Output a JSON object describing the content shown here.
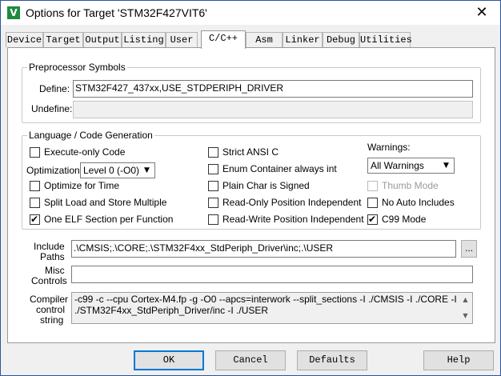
{
  "window": {
    "title": "Options for Target 'STM32F427VIT6'",
    "close_glyph": "✕",
    "app_icon_glyph": "V"
  },
  "tabs": [
    "Device",
    "Target",
    "Output",
    "Listing",
    "User",
    "C/C++",
    "Asm",
    "Linker",
    "Debug",
    "Utilities"
  ],
  "preprocessor": {
    "group_label": "Preprocessor Symbols",
    "define_label": "Define:",
    "define_value": "STM32F427_437xx,USE_STDPERIPH_DRIVER",
    "undefine_label": "Undefine:",
    "undefine_value": ""
  },
  "language": {
    "group_label": "Language / Code Generation",
    "execute_only": "Execute-only Code",
    "optimization_label": "Optimization:",
    "optimization_value": "Level 0 (-O0)",
    "optimize_time": "Optimize for Time",
    "split_load": "Split Load and Store Multiple",
    "one_elf": "One ELF Section per Function",
    "strict_ansi": "Strict ANSI C",
    "enum_container": "Enum Container always int",
    "plain_char": "Plain Char is Signed",
    "ro_pi": "Read-Only Position Independent",
    "rw_pi": "Read-Write Position Independent",
    "warnings_label": "Warnings:",
    "warnings_value": "All Warnings",
    "thumb_mode": "Thumb Mode",
    "no_auto_includes": "No Auto Includes",
    "c99_mode": "C99 Mode",
    "check_glyph": "✔",
    "arrow_glyph": "▼"
  },
  "include": {
    "label_line1": "Include",
    "label_line2": "Paths",
    "value": ".\\CMSIS;.\\CORE;.\\STM32F4xx_StdPeriph_Driver\\inc;.\\USER",
    "browse": "..."
  },
  "misc": {
    "label_line1": "Misc",
    "label_line2": "Controls",
    "value": ""
  },
  "compiler": {
    "label_line1": "Compiler",
    "label_line2": "control",
    "label_line3": "string",
    "line1": "-c99 -c --cpu Cortex-M4.fp -g -O0 --apcs=interwork --split_sections -I ./CMSIS -I ./CORE -I",
    "line2": "./STM32F4xx_StdPeriph_Driver/inc -I ./USER",
    "up": "▲",
    "down": "▼"
  },
  "buttons": {
    "ok": "OK",
    "cancel": "Cancel",
    "defaults": "Defaults",
    "help": "Help"
  }
}
